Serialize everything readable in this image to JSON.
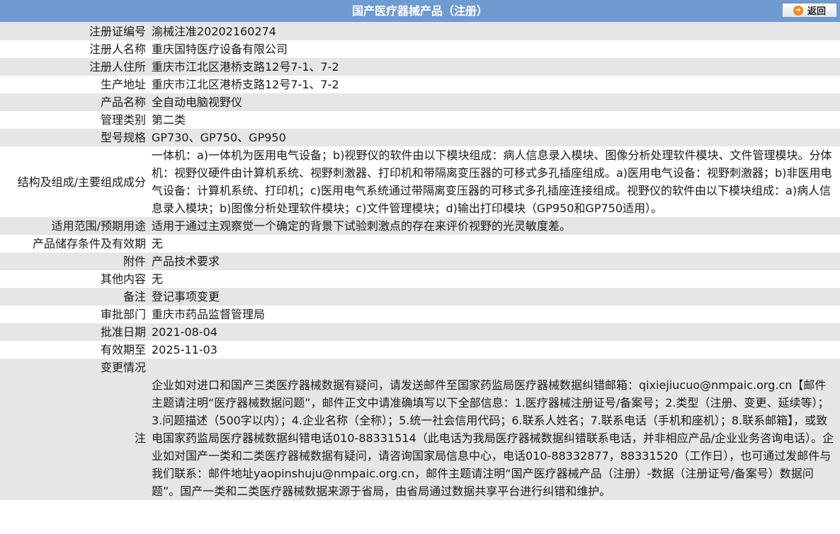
{
  "header": {
    "title": "国产医疗器械产品（注册）",
    "back_label": "返回"
  },
  "fields": [
    {
      "label": "注册证编号",
      "value": "渝械注准20202160274"
    },
    {
      "label": "注册人名称",
      "value": "重庆国特医疗设备有限公司"
    },
    {
      "label": "注册人住所",
      "value": "重庆市江北区港桥支路12号7-1、7-2"
    },
    {
      "label": "生产地址",
      "value": "重庆市江北区港桥支路12号7-1、7-2"
    },
    {
      "label": "产品名称",
      "value": "全自动电脑视野仪"
    },
    {
      "label": "管理类别",
      "value": "第二类"
    },
    {
      "label": "型号规格",
      "value": "GP730、GP750、GP950"
    },
    {
      "label": "结构及组成/主要组成成分",
      "value": "一体机：a)一体机为医用电气设备；b)视野仪的软件由以下模块组成：病人信息录入模块、图像分析处理软件模块、文件管理模块。分体机：视野仪硬件由计算机系统、视野刺激器、打印机和带隔离变压器的可移式多孔插座组成。a)医用电气设备：视野刺激器；b)非医用电气设备：计算机系统、打印机；c)医用电气系统通过带隔离变压器的可移式多孔插座连接组成。视野仪的软件由以下模块组成：a)病人信息录入模块；b)图像分析处理软件模块；c)文件管理模块；d)输出打印模块（GP950和GP750适用）。"
    },
    {
      "label": "适用范围/预期用途",
      "value": "适用于通过主观察觉一个确定的背景下试验刺激点的存在来评价视野的光灵敏度差。"
    },
    {
      "label": "产品储存条件及有效期",
      "value": "无"
    },
    {
      "label": "附件",
      "value": "产品技术要求"
    },
    {
      "label": "其他内容",
      "value": "无"
    },
    {
      "label": "备注",
      "value": "登记事项变更"
    },
    {
      "label": "审批部门",
      "value": "重庆市药品监督管理局"
    },
    {
      "label": "批准日期",
      "value": "2021-08-04"
    },
    {
      "label": "有效期至",
      "value": "2025-11-03"
    },
    {
      "label": "变更情况",
      "value": ""
    }
  ],
  "note": {
    "label": "注",
    "text": "企业如对进口和国产三类医疗器械数据有疑问，请发送邮件至国家药监局医疗器械数据纠错邮箱：qixiejiucuo@nmpaic.org.cn【邮件主题请注明“医疗器械数据问题”，邮件正文中请准确填写以下全部信息：1.医疗器械注册证号/备案号；2.类型（注册、变更、延续等）；3.问题描述（500字以内）；4.企业名称（全称）；5.统一社会信用代码；6.联系人姓名；7.联系电话（手机和座机）；8.联系邮箱】，或致电国家药监局医疗器械数据纠错电话010-88331514（此电话为我局医疗器械数据纠错联系电话，并非相应产品/企业业务咨询电话）。企业如对国产一类和二类医疗器械数据有疑问，请咨询国家局信息中心，电话010-88332877，88331520（工作日），也可通过发邮件与我们联系：邮件地址yaopinshuju@nmpaic.org.cn，邮件主题请注明“国产医疗器械产品（注册）-数据（注册证号/备案号）数据问题”。国产一类和二类医疗器械数据来源于省局，由省局通过数据共享平台进行纠错和维护。"
  },
  "icons": {
    "back": "arrow-right-icon"
  },
  "colors": {
    "header_bg": "#6f9bd0",
    "row_alt": "#e6e6e6",
    "icon_orange": "#f08a1c"
  }
}
